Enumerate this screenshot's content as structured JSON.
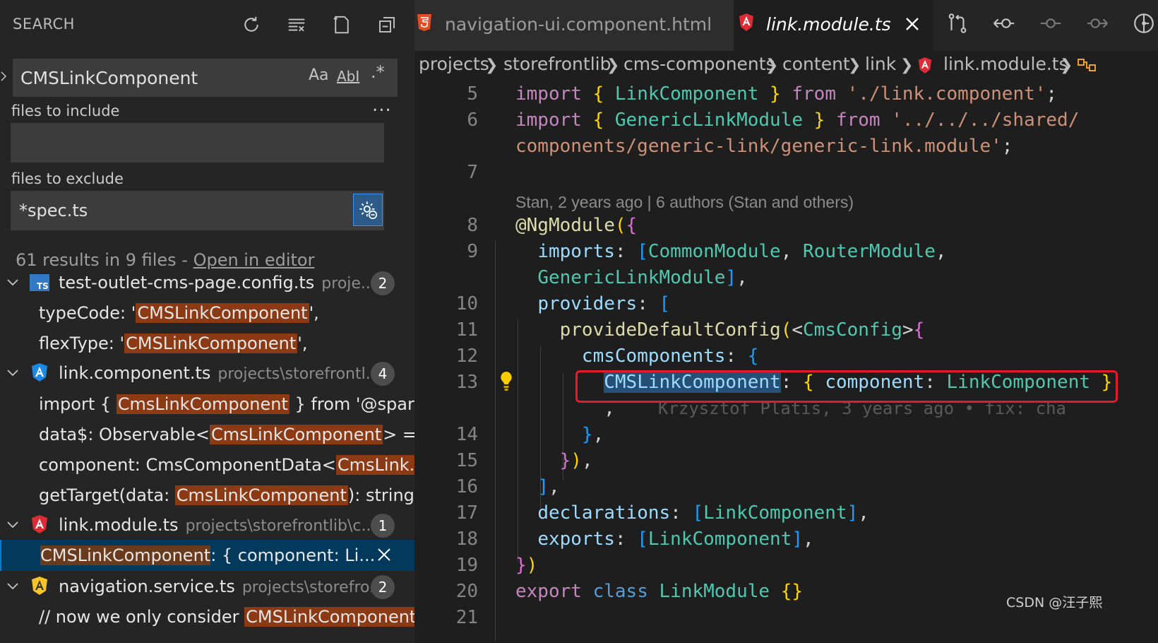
{
  "sidebar": {
    "title": "SEARCH",
    "search_value": "CMSLinkComponent",
    "options": {
      "case": "Aa",
      "word": "AbI",
      "regex": ".*"
    },
    "more": "...",
    "include_label": "files to include",
    "include_value": "",
    "exclude_label": "files to exclude",
    "exclude_value": "*spec.ts",
    "summary_text": "61 results in 9 files - ",
    "summary_link": "Open in editor",
    "results": [
      {
        "name": "test-outlet-cms-page.config.ts",
        "path": "proje...",
        "count": "2",
        "icon": "ts-icon"
      },
      {
        "pre": "typeCode: '",
        "hit": "CMSLinkComponent",
        "post": "',"
      },
      {
        "pre": "flexType: '",
        "hit": "CMSLinkComponent",
        "post": "',"
      },
      {
        "name": "link.component.ts",
        "path": "projects\\storefrontl...",
        "count": "4",
        "icon": "angular-component-icon"
      },
      {
        "pre": "import { ",
        "hit": "CmsLinkComponent",
        "post": " } from '@spar..."
      },
      {
        "pre": "data$: Observable<",
        "hit": "CmsLinkComponent",
        "post": "> =..."
      },
      {
        "pre": "component: CmsComponentData<",
        "hit": "CmsLink...",
        "post": ""
      },
      {
        "pre": "getTarget(data: ",
        "hit": "CmsLinkComponent",
        "post": "): string..."
      },
      {
        "name": "link.module.ts",
        "path": "projects\\storefrontlib\\c...",
        "count": "1",
        "icon": "angular-module-icon"
      },
      {
        "pre": "",
        "hit": "CMSLinkComponent",
        "post": ": { component: Li..."
      },
      {
        "name": "navigation.service.ts",
        "path": "projects\\storefro...",
        "count": "2",
        "icon": "angular-service-icon"
      },
      {
        "pre": "// now we only consider ",
        "hit": "CMSLinkComponent",
        "post": ""
      }
    ]
  },
  "tabs": [
    {
      "label": "navigation-ui.component.html"
    },
    {
      "label": "link.module.ts"
    }
  ],
  "breadcrumb": [
    "projects",
    "storefrontlib",
    "cms-components",
    "content",
    "link",
    "link.module.ts"
  ],
  "code": {
    "line_numbers": [
      "5",
      "6",
      "7",
      "8",
      "9",
      "10",
      "11",
      "12",
      "13",
      "14",
      "15",
      "16",
      "17",
      "18",
      "19",
      "20",
      "21"
    ],
    "blame": "Stan, 2 years ago | 6 authors (Stan and others)",
    "ghost": "Krzysztof Platis, 3 years ago • fix: cha",
    "import_kw": "import",
    "from_kw": "from",
    "link_component": "LinkComponent",
    "link_component_path": "'./link.component'",
    "generic_link_module": "GenericLinkModule",
    "generic_path_1": "'../../../shared/",
    "generic_path_2": "components/generic-link/generic-link.module'",
    "decorator": "@NgModule",
    "imports_key": "imports",
    "common_module": "CommonModule",
    "router_module": "RouterModule",
    "providers_key": "providers",
    "provide_fn": "provideDefaultConfig",
    "cms_config": "CmsConfig",
    "cms_components_key": "cmsComponents",
    "cms_link_key": "CMSLinkComponent",
    "component_key": "component",
    "declarations_key": "declarations",
    "exports_key": "exports",
    "export_kw": "export",
    "class_kw": "class",
    "class_name": "LinkModule"
  },
  "watermark": "CSDN @汪子熙"
}
